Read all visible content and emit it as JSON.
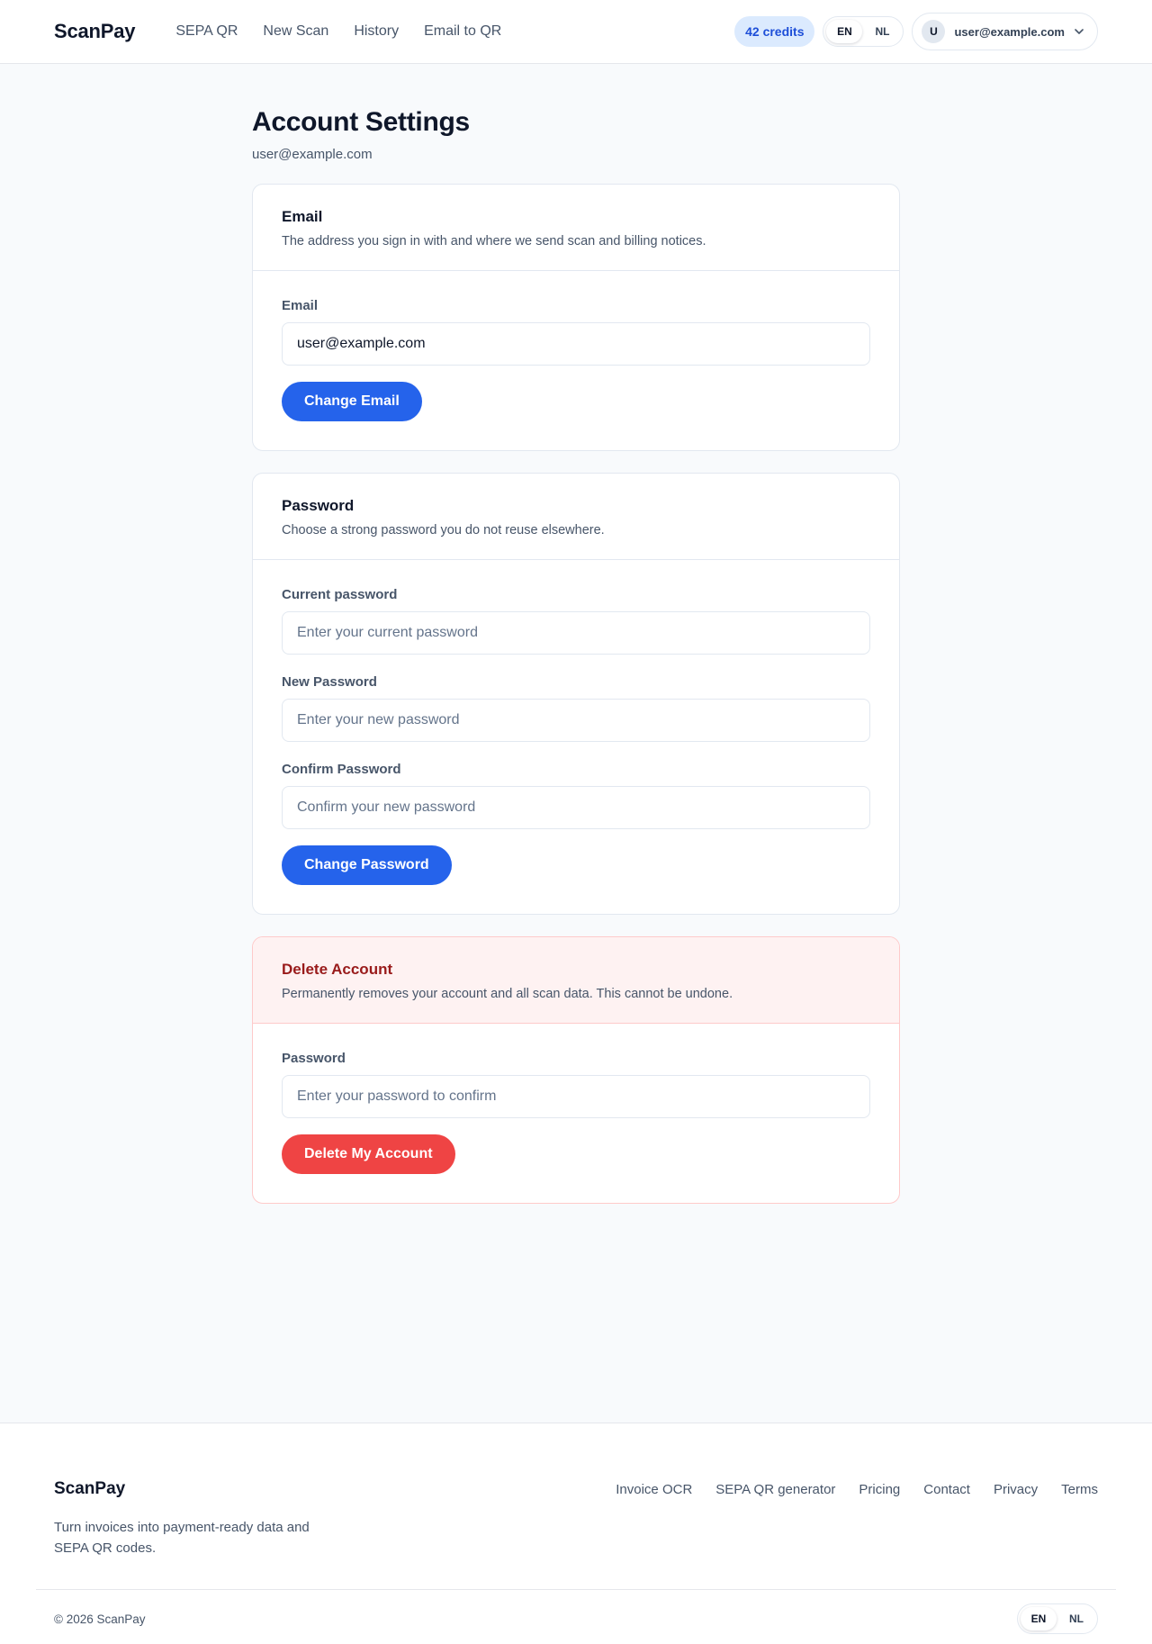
{
  "header": {
    "brand": "ScanPay",
    "nav": [
      "SEPA QR",
      "New Scan",
      "History",
      "Email to QR"
    ],
    "credits": "42 credits",
    "lang": [
      "EN",
      "NL"
    ],
    "avatar_initial": "U",
    "user_email": "user@example.com"
  },
  "page": {
    "title": "Account Settings",
    "subtitle": "user@example.com"
  },
  "email_card": {
    "title": "Email",
    "description": "The address you sign in with and where we send scan and billing notices.",
    "field_label": "Email",
    "field_value": "user@example.com",
    "button": "Change Email"
  },
  "password_card": {
    "title": "Password",
    "description": "Choose a strong password you do not reuse elsewhere.",
    "current_label": "Current password",
    "current_placeholder": "Enter your current password",
    "new_label": "New Password",
    "new_placeholder": "Enter your new password",
    "confirm_label": "Confirm Password",
    "confirm_placeholder": "Confirm your new password",
    "button": "Change Password"
  },
  "delete_card": {
    "title": "Delete Account",
    "description": "Permanently removes your account and all scan data. This cannot be undone.",
    "password_label": "Password",
    "password_placeholder": "Enter your password to confirm",
    "button": "Delete My Account"
  },
  "footer": {
    "brand": "ScanPay",
    "tagline": "Turn invoices into payment-ready data and SEPA QR codes.",
    "links": [
      "Invoice OCR",
      "SEPA QR generator",
      "Pricing",
      "Contact",
      "Privacy",
      "Terms"
    ],
    "copyright": "© 2026 ScanPay",
    "lang": [
      "EN",
      "NL"
    ]
  },
  "colors": {
    "primary": "#2563eb",
    "danger": "#ef4444",
    "danger_title": "#991b1b",
    "danger_bg": "#fef2f2",
    "credits_bg": "#dbeafe"
  }
}
